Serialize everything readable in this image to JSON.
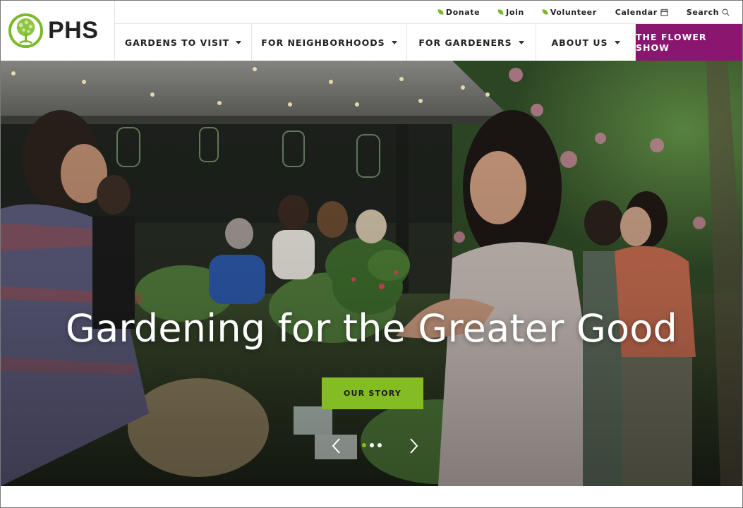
{
  "brand": {
    "name": "PHS",
    "logo_icon": "tree-in-circle-icon",
    "colors": {
      "green": "#84bc23",
      "leaf": "#7ab929",
      "magenta": "#8b166f",
      "text": "#222222"
    }
  },
  "utility_nav": [
    {
      "label": "Donate",
      "icon": "leaf-icon"
    },
    {
      "label": "Join",
      "icon": "leaf-icon"
    },
    {
      "label": "Volunteer",
      "icon": "leaf-icon"
    },
    {
      "label": "Calendar",
      "icon": "calendar-icon"
    },
    {
      "label": "Search",
      "icon": "search-icon"
    }
  ],
  "main_nav": [
    {
      "label": "GARDENS TO VISIT",
      "has_dropdown": true
    },
    {
      "label": "FOR NEIGHBORHOODS",
      "has_dropdown": true
    },
    {
      "label": "FOR GARDENERS",
      "has_dropdown": true
    },
    {
      "label": "ABOUT US",
      "has_dropdown": true
    },
    {
      "label": "THE FLOWER SHOW",
      "has_dropdown": false,
      "highlight": true
    }
  ],
  "hero": {
    "headline": "Gardening for the Greater Good",
    "cta_label": "OUR STORY",
    "image_description": "People shopping for plants at an outdoor garden market under string lights",
    "carousel": {
      "slide_count": 3,
      "active_slide": 1,
      "prev_icon": "chevron-left-icon",
      "next_icon": "chevron-right-icon"
    }
  }
}
